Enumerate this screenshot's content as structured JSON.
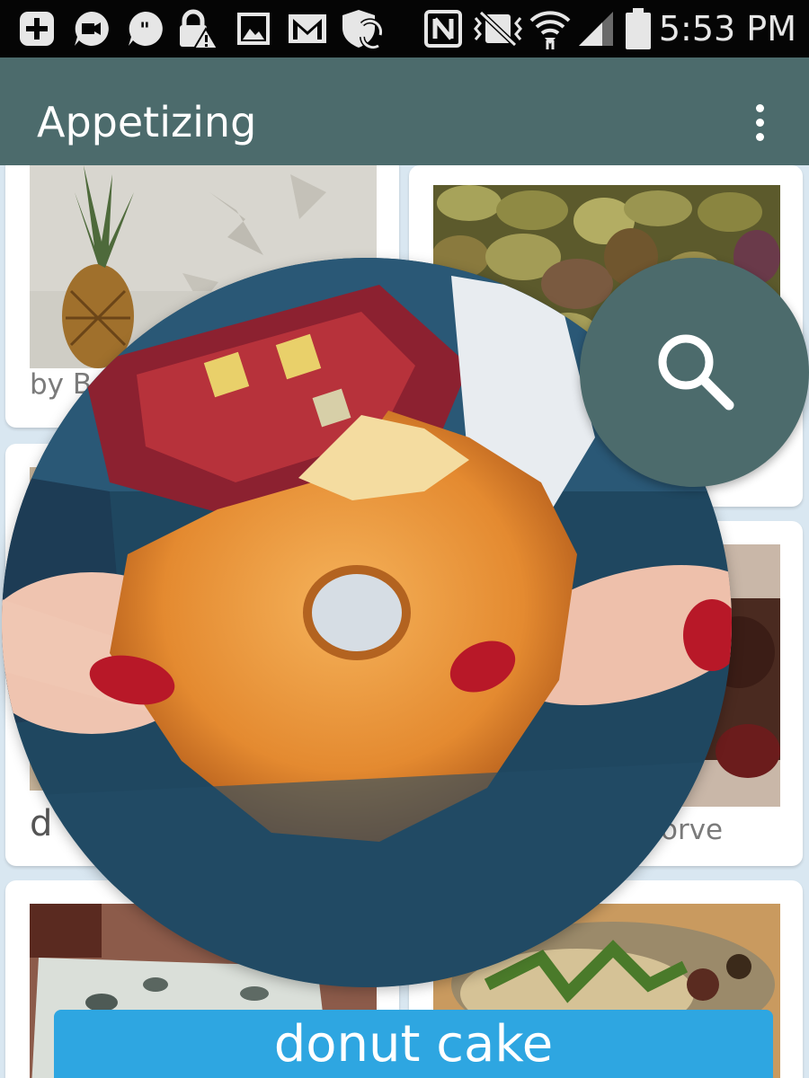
{
  "status_bar": {
    "time": "5:53 PM",
    "icons": [
      "add-box-icon",
      "video-chat-icon",
      "chat-quote-icon",
      "lock-alert-icon",
      "image-icon",
      "gmail-icon",
      "shield-sync-icon",
      "nfc-icon",
      "vibrate-off-icon",
      "wifi-icon",
      "signal-icon",
      "battery-icon"
    ]
  },
  "app_bar": {
    "title": "Appetizing",
    "overflow_icon": "more-vert-icon"
  },
  "grid": {
    "cards": [
      {
        "photo": "pineapple",
        "caption": "by B"
      },
      {
        "photo": "pistachios",
        "caption": ""
      },
      {
        "photo": "left-card",
        "caption": "d"
      },
      {
        "photo": "chocolate-dessert",
        "caption": "orve"
      },
      {
        "photo": "blue-cheese",
        "caption": ""
      },
      {
        "photo": "noodle-salad",
        "caption": ""
      }
    ]
  },
  "preview": {
    "photo": "donut-held-in-hands",
    "label": "donut cake"
  },
  "fab": {
    "icon": "search-icon",
    "color": "#4c6b6c"
  },
  "colors": {
    "primary": "#4c6b6c",
    "accent": "#2ea6e1",
    "background": "#d9e7f1"
  }
}
